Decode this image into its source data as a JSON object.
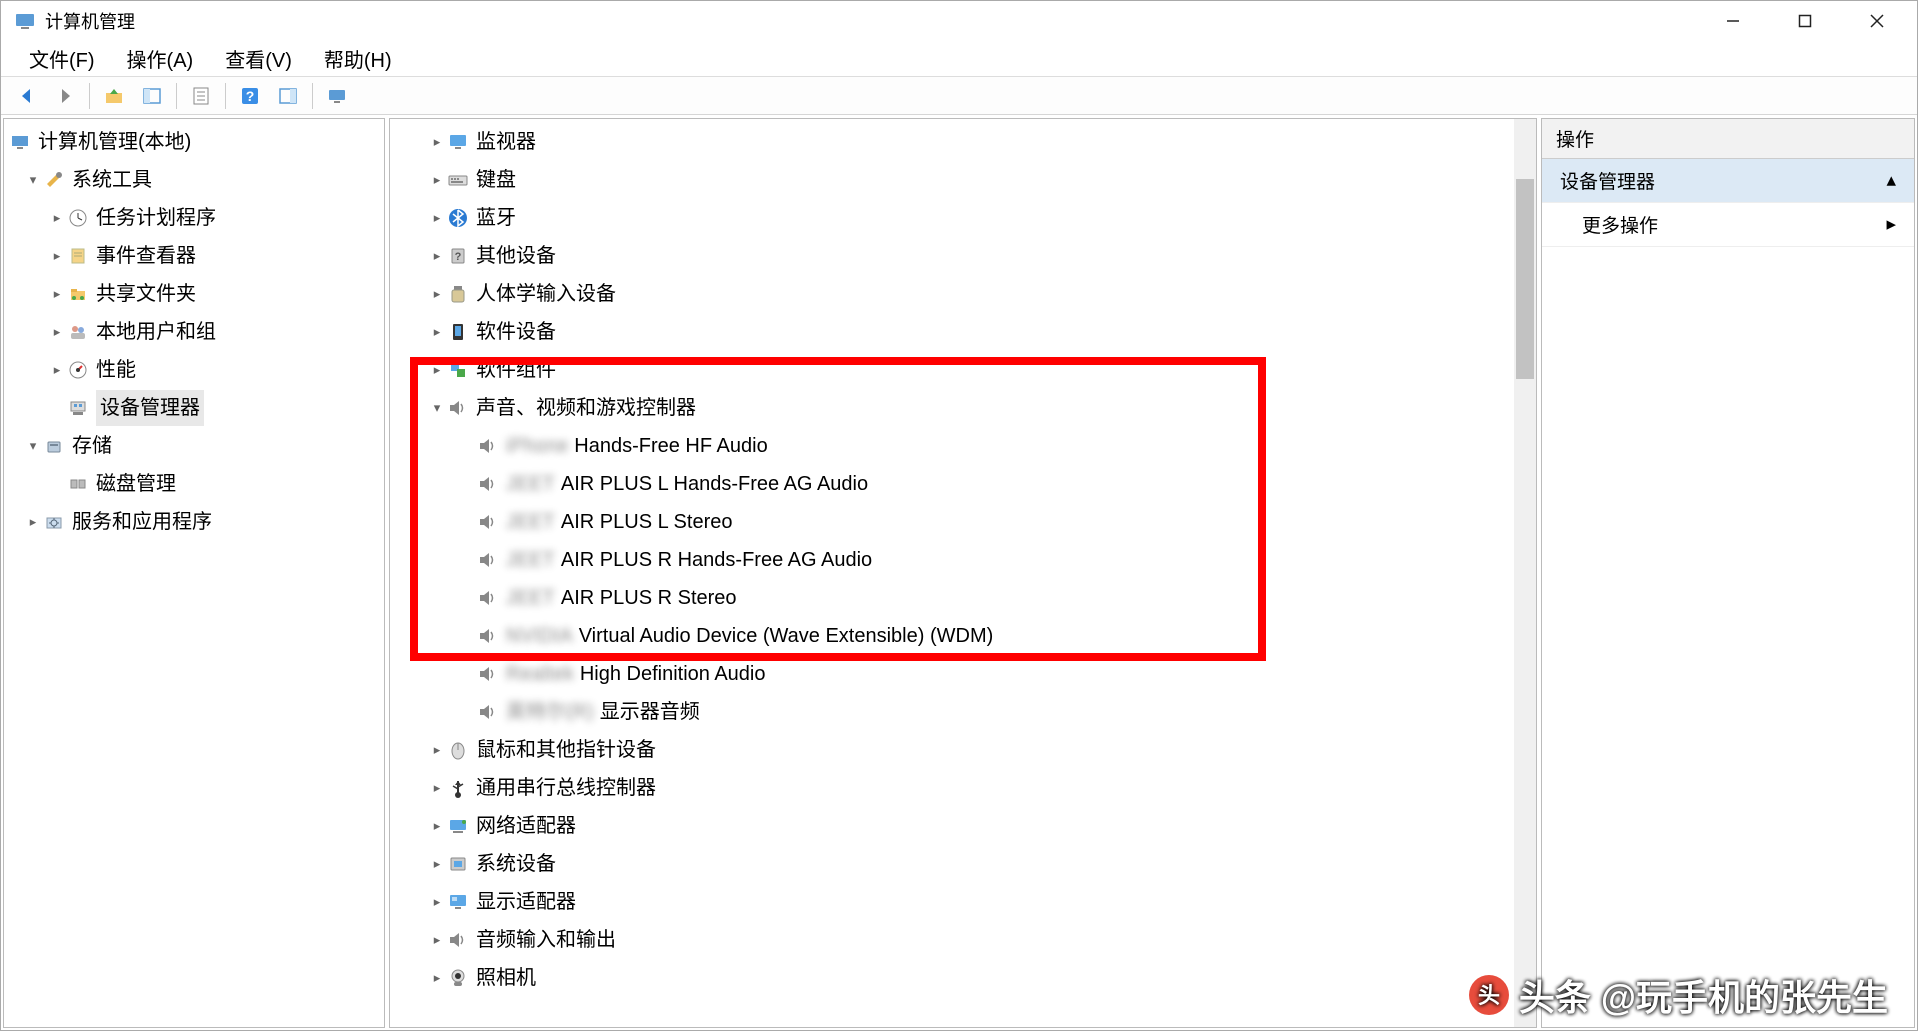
{
  "window": {
    "title": "计算机管理"
  },
  "menu": {
    "file": "文件(F)",
    "action": "操作(A)",
    "view": "查看(V)",
    "help": "帮助(H)"
  },
  "left_tree": {
    "root": "计算机管理(本地)",
    "system_tools": "系统工具",
    "task_scheduler": "任务计划程序",
    "event_viewer": "事件查看器",
    "shared_folders": "共享文件夹",
    "local_users": "本地用户和组",
    "performance": "性能",
    "device_manager": "设备管理器",
    "storage": "存储",
    "disk_mgmt": "磁盘管理",
    "services": "服务和应用程序"
  },
  "devices": [
    {
      "label": "监视器",
      "icon": "monitor-icon",
      "expandable": true
    },
    {
      "label": "键盘",
      "icon": "keyboard-icon",
      "expandable": true
    },
    {
      "label": "蓝牙",
      "icon": "bluetooth-icon",
      "expandable": true
    },
    {
      "label": "其他设备",
      "icon": "other-device-icon",
      "expandable": true
    },
    {
      "label": "人体学输入设备",
      "icon": "hid-icon",
      "expandable": true
    },
    {
      "label": "软件设备",
      "icon": "software-device-icon",
      "expandable": true
    },
    {
      "label": "软件组件",
      "icon": "software-component-icon",
      "expandable": true
    },
    {
      "label": "声音、视频和游戏控制器",
      "icon": "speaker-icon",
      "expandable": true,
      "expanded": true
    },
    {
      "label": "鼠标和其他指针设备",
      "icon": "mouse-icon",
      "expandable": true
    },
    {
      "label": "通用串行总线控制器",
      "icon": "usb-icon",
      "expandable": true
    },
    {
      "label": "网络适配器",
      "icon": "network-icon",
      "expandable": true
    },
    {
      "label": "系统设备",
      "icon": "system-device-icon",
      "expandable": true
    },
    {
      "label": "显示适配器",
      "icon": "display-adapter-icon",
      "expandable": true
    },
    {
      "label": "音频输入和输出",
      "icon": "audio-io-icon",
      "expandable": true
    },
    {
      "label": "照相机",
      "icon": "camera-icon",
      "expandable": true
    }
  ],
  "sound_children": [
    {
      "label_prefix": "iPhone",
      "label": "Hands-Free HF Audio"
    },
    {
      "label_prefix": "JEET",
      "label": "AIR PLUS L Hands-Free AG Audio"
    },
    {
      "label_prefix": "JEET",
      "label": "AIR PLUS L Stereo"
    },
    {
      "label_prefix": "JEET",
      "label": "AIR PLUS R Hands-Free AG Audio"
    },
    {
      "label_prefix": "JEET",
      "label": "AIR PLUS R Stereo"
    },
    {
      "label_prefix": "NVIDIA",
      "label": "Virtual Audio Device (Wave Extensible) (WDM)"
    },
    {
      "label_prefix": "Realtek",
      "label": "High Definition Audio"
    },
    {
      "label_prefix": "英特尔(R)",
      "label": "显示器音频"
    }
  ],
  "actions_panel": {
    "header": "操作",
    "section": "设备管理器",
    "more": "更多操作"
  },
  "watermark": "头条 @玩手机的张先生"
}
